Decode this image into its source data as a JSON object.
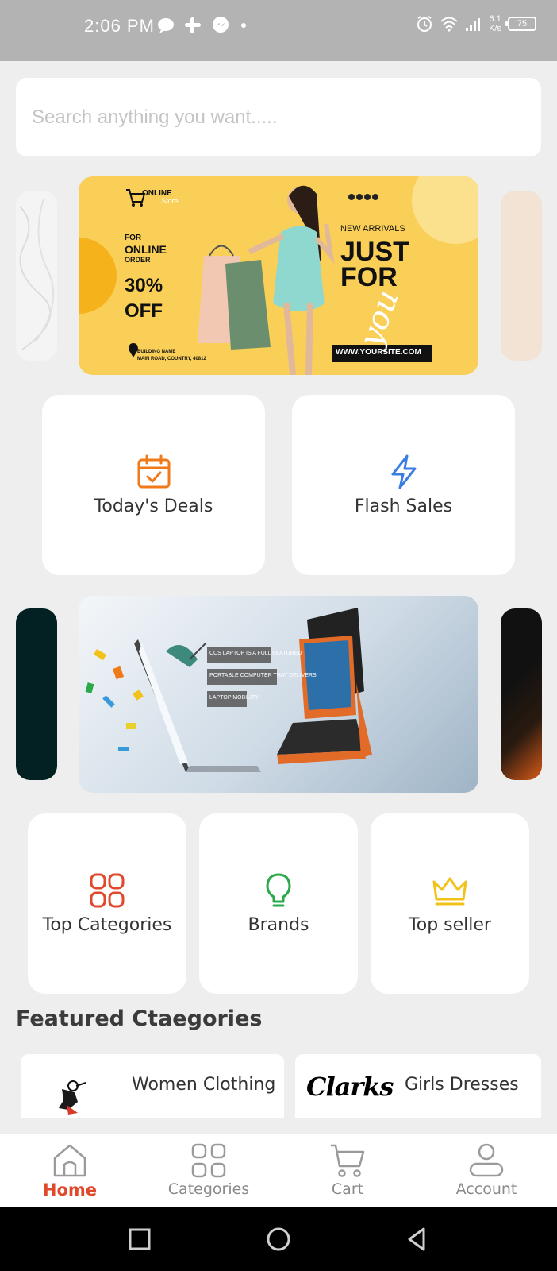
{
  "status_bar": {
    "time": "2:06 PM",
    "net_speed_value": "6.1",
    "net_speed_unit": "K/s",
    "battery": "75"
  },
  "search": {
    "placeholder": "Search anything you want....."
  },
  "banner1": {
    "brand_line1": "ONLINE",
    "brand_line2": "Store",
    "for_line": "FOR",
    "online_line": "ONLINE",
    "order_line": "ORDER",
    "discount": "30%",
    "off": "OFF",
    "new_arrivals": "NEW ARRIVALS",
    "headline1": "JUST",
    "headline2": "FOR",
    "headline3": "you",
    "address1": "BUILDING NAME",
    "address2": "MAIN ROAD, COUNTRY, 40812",
    "website": "WWW.YOURSITE.COM"
  },
  "banner2": {
    "line1": "CCS LAPTOP IS A FULL FEATURED",
    "line2": "PORTABLE COMPUTER THAT DELIVERS",
    "line3": "LAPTOP MOBILITY."
  },
  "quick_cards_row1": [
    {
      "label": "Today's Deals",
      "icon": "calendar-check-icon",
      "color": "#f07a1a"
    },
    {
      "label": "Flash Sales",
      "icon": "lightning-icon",
      "color": "#3a7de0"
    }
  ],
  "quick_cards_row2": [
    {
      "label": "Top Categories",
      "icon": "grid-icon",
      "color": "#e0492b"
    },
    {
      "label": "Brands",
      "icon": "lightbulb-icon",
      "color": "#2aa84a"
    },
    {
      "label": "Top seller",
      "icon": "crown-icon",
      "color": "#f2c21b"
    }
  ],
  "featured": {
    "title": "Featured Ctaegories",
    "items": [
      {
        "label": "Women Clothing",
        "logo": "women-clothing-logo"
      },
      {
        "label": "Girls Dresses",
        "logo": "clarks-logo",
        "logo_text": "Clarks"
      }
    ]
  },
  "bottom_nav": [
    {
      "label": "Home",
      "icon": "home-icon",
      "active": true
    },
    {
      "label": "Categories",
      "icon": "categories-icon",
      "active": false
    },
    {
      "label": "Cart",
      "icon": "cart-icon",
      "active": false
    },
    {
      "label": "Account",
      "icon": "account-icon",
      "active": false
    }
  ],
  "colors": {
    "accent": "#e0492b",
    "background": "#eeeeee",
    "banner_yellow": "#f9cf58"
  }
}
